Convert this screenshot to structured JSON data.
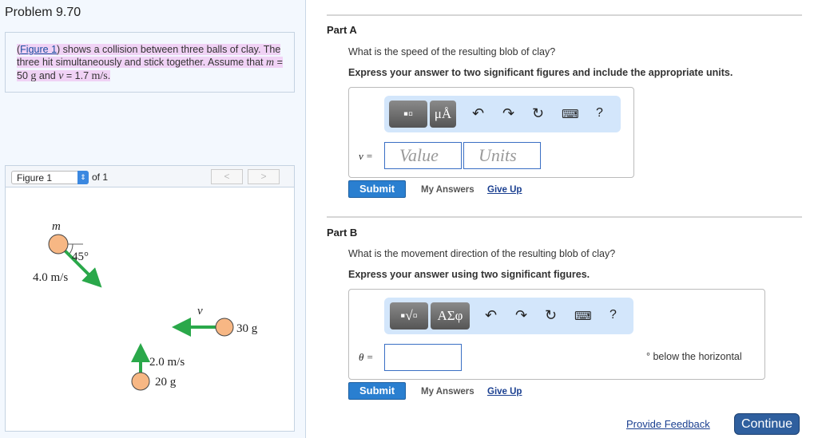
{
  "title": "Problem 9.70",
  "question": {
    "link": "Figure 1",
    "t1": ") shows a collision between three balls of clay. The three hit simultaneously and stick together. Assume that ",
    "m": "m",
    "eq1": " = 50 ",
    "g": "g",
    "and": " and ",
    "v": "v",
    "eq2": " = 1.7 ",
    "ms": "m/s",
    "end": "."
  },
  "figure_nav": {
    "select": "Figure 1",
    "of": "of 1",
    "prev": "<",
    "next": ">"
  },
  "figure": {
    "m": "m",
    "angle": "45°",
    "v1": "4.0 m/s",
    "v": "v",
    "mass30": "30 g",
    "v3": "2.0 m/s",
    "mass20": "20 g"
  },
  "partA": {
    "label": "Part A",
    "question": "What is the speed of the resulting blob of clay?",
    "instruction": "Express your answer to two significant figures and include the appropriate units.",
    "tool2": "μÅ",
    "help": "?",
    "var": "v =",
    "value_ph": "Value",
    "units_ph": "Units",
    "submit": "Submit",
    "my_answers": "My Answers",
    "give_up": "Give Up"
  },
  "partB": {
    "label": "Part B",
    "question": "What is the movement direction of the resulting blob of clay?",
    "instruction": "Express your answer using two significant figures.",
    "tool2": "ΑΣφ",
    "help": "?",
    "var": "θ =",
    "unit_suffix": "° below the horizontal",
    "submit": "Submit",
    "my_answers": "My Answers",
    "give_up": "Give Up"
  },
  "footer": {
    "feedback": "Provide Feedback",
    "continue": "Continue"
  }
}
